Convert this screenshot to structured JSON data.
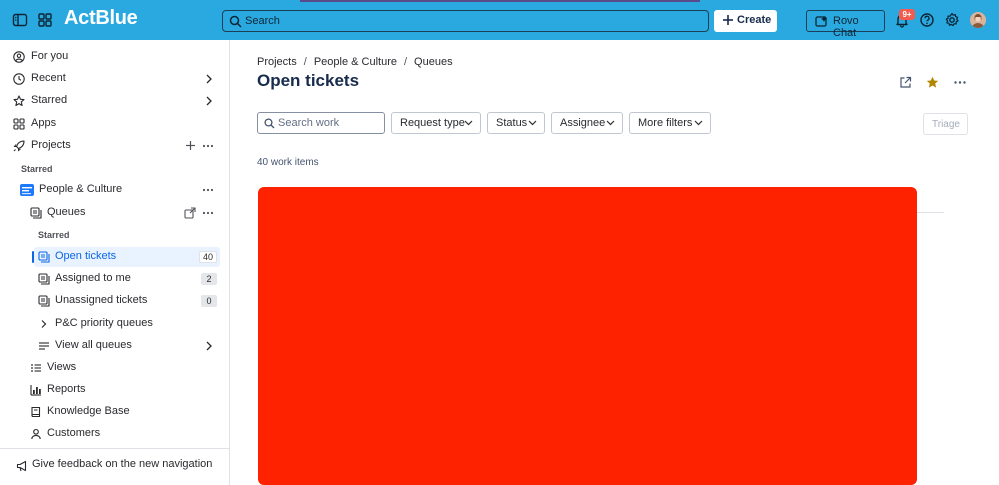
{
  "topbar": {
    "logo": "ActBlue",
    "search_label": "Search",
    "create_label": "Create",
    "rovo_label": "Rovo Chat",
    "notification_count": "9+",
    "icons": [
      "sidebar-toggle-icon",
      "app-switcher-icon",
      "search-icon",
      "plus-icon",
      "rovo-icon",
      "bell-icon",
      "help-icon",
      "gear-icon"
    ],
    "colors": {
      "bar": "#2aa9e0",
      "badge": "#f15b50"
    }
  },
  "sidebar": {
    "for_you": "For you",
    "recent": "Recent",
    "starred": "Starred",
    "apps": "Apps",
    "projects": "Projects",
    "starred_section": "Starred",
    "project": "People & Culture",
    "queues": "Queues",
    "queues_starred_section": "Starred",
    "queue_items": [
      {
        "label": "Open tickets",
        "count": "40"
      },
      {
        "label": "Assigned to me",
        "count": "2"
      },
      {
        "label": "Unassigned tickets",
        "count": "0"
      }
    ],
    "priority_queues": "P&C priority queues",
    "view_all_queues": "View all queues",
    "views": "Views",
    "reports": "Reports",
    "knowledge_base": "Knowledge Base",
    "customers": "Customers",
    "feedback": "Give feedback on the new navigation"
  },
  "main": {
    "breadcrumb": [
      "Projects",
      "People & Culture",
      "Queues"
    ],
    "title": "Open tickets",
    "search_placeholder": "Search work",
    "filters": [
      "Request type",
      "Status",
      "Assignee",
      "More filters"
    ],
    "triage_label": "Triage",
    "work_items_count": "40 work items",
    "accent": "#0c66e4",
    "star_color": "#b38600",
    "redaction_color": "#ff2200"
  }
}
